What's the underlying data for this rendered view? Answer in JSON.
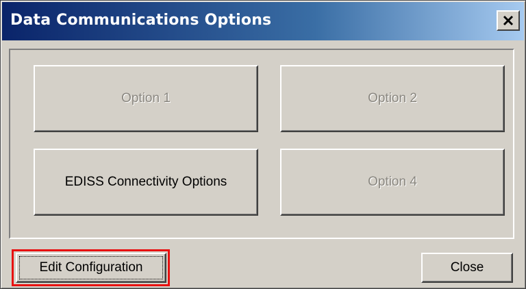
{
  "window": {
    "title": "Data Communications Options",
    "close_glyph": "✕",
    "close_icon": "close-icon"
  },
  "options": {
    "option_1": {
      "label": "Option 1",
      "enabled": false
    },
    "option_2": {
      "label": "Option 2",
      "enabled": false
    },
    "option_3": {
      "label": "EDISS Connectivity Options",
      "enabled": true
    },
    "option_4": {
      "label": "Option 4",
      "enabled": false
    }
  },
  "footer": {
    "edit_label": "Edit Configuration",
    "close_label": "Close"
  },
  "colors": {
    "titlebar_start": "#0a246a",
    "titlebar_end": "#a6caf0",
    "face": "#d4d0c8",
    "highlight": "#e81010",
    "disabled_text": "#8a8780"
  }
}
